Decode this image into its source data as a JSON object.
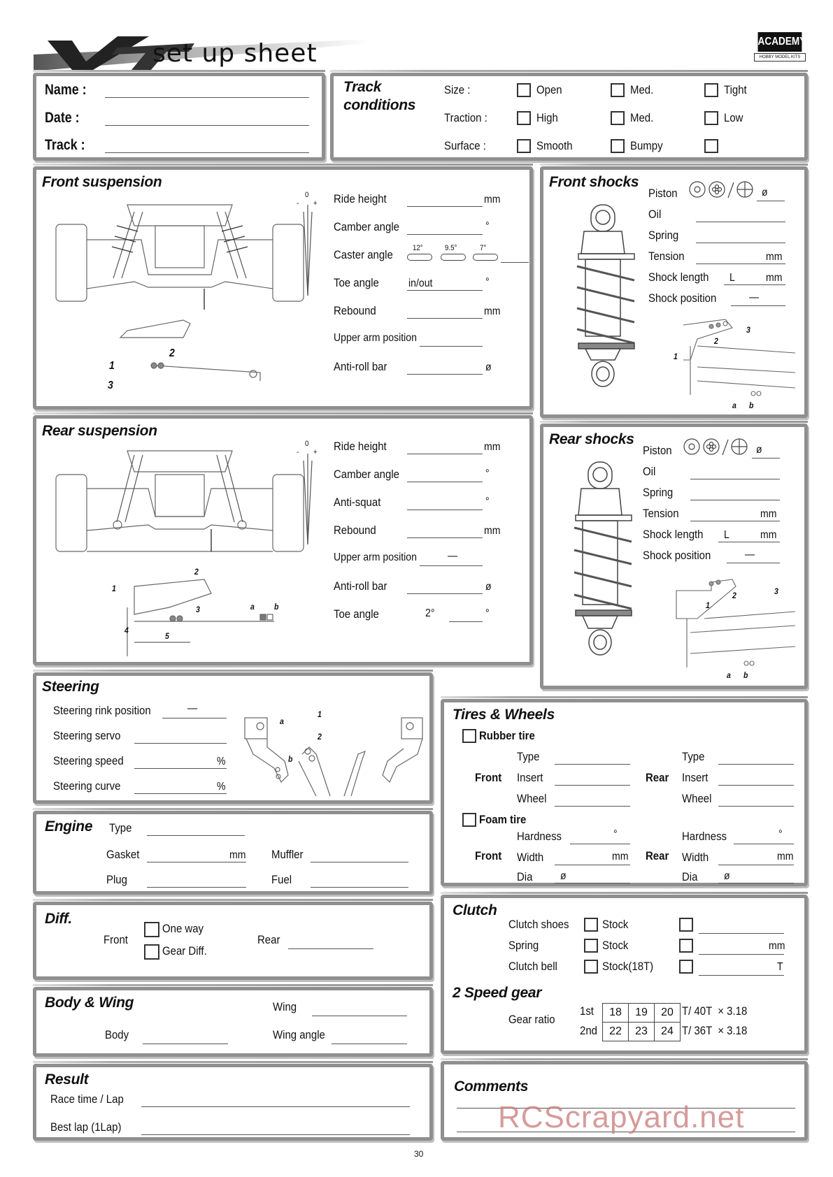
{
  "header": {
    "logo_text": "VT",
    "title": "set up sheet",
    "brand": "ACADEMY",
    "brand_sub": "HOBBY MODEL KITS"
  },
  "info": {
    "name_label": "Name :",
    "date_label": "Date :",
    "track_label": "Track :"
  },
  "track_conditions": {
    "title_line1": "Track",
    "title_line2": "conditions",
    "rows": [
      {
        "label": "Size :",
        "options": [
          "Open",
          "Med.",
          "Tight"
        ]
      },
      {
        "label": "Traction :",
        "options": [
          "High",
          "Med.",
          "Low"
        ]
      },
      {
        "label": "Surface :",
        "options": [
          "Smooth",
          "Bumpy",
          ""
        ]
      }
    ]
  },
  "front_suspension": {
    "title": "Front suspension",
    "gauge": {
      "zero": "0",
      "minus": "-",
      "plus": "+"
    },
    "fields": [
      {
        "label": "Ride height",
        "unit": "mm"
      },
      {
        "label": "Camber angle",
        "unit": "°"
      },
      {
        "label": "Caster angle",
        "unit": ""
      },
      {
        "label": "Toe angle",
        "unit": "°",
        "value": "in/out"
      },
      {
        "label": "Rebound",
        "unit": "mm"
      },
      {
        "label": "Upper arm position",
        "unit": ""
      },
      {
        "label": "Anti-roll bar",
        "unit": "ø"
      }
    ],
    "caster_options": [
      "12°",
      "9.5°",
      "7°"
    ],
    "diagram_labels": [
      "1",
      "2",
      "3"
    ]
  },
  "front_shocks": {
    "title": "Front shocks",
    "fields": [
      {
        "label": "Piston",
        "unit": "ø"
      },
      {
        "label": "Oil",
        "unit": ""
      },
      {
        "label": "Spring",
        "unit": ""
      },
      {
        "label": "Tension",
        "unit": "mm"
      },
      {
        "label": "Shock length",
        "unit": "mm",
        "prefix": "L"
      },
      {
        "label": "Shock position",
        "unit": "",
        "value": "—"
      }
    ],
    "diagram_labels": [
      "1",
      "2",
      "3",
      "a",
      "b"
    ]
  },
  "rear_suspension": {
    "title": "Rear suspension",
    "gauge": {
      "zero": "0",
      "minus": "-",
      "plus": "+"
    },
    "fields": [
      {
        "label": "Ride height",
        "unit": "mm"
      },
      {
        "label": "Camber angle",
        "unit": "°"
      },
      {
        "label": "Anti-squat",
        "unit": "°"
      },
      {
        "label": "Rebound",
        "unit": "mm"
      },
      {
        "label": "Upper arm position",
        "unit": "",
        "value": "—"
      },
      {
        "label": "Anti-roll bar",
        "unit": "ø"
      },
      {
        "label": "Toe angle",
        "unit": "°",
        "value": "2°"
      }
    ],
    "diagram_labels": [
      "1",
      "2",
      "3",
      "4",
      "5",
      "a",
      "b"
    ]
  },
  "rear_shocks": {
    "title": "Rear shocks",
    "fields": [
      {
        "label": "Piston",
        "unit": "ø"
      },
      {
        "label": "Oil",
        "unit": ""
      },
      {
        "label": "Spring",
        "unit": ""
      },
      {
        "label": "Tension",
        "unit": "mm"
      },
      {
        "label": "Shock length",
        "unit": "mm",
        "prefix": "L"
      },
      {
        "label": "Shock position",
        "unit": "",
        "value": "—"
      }
    ],
    "diagram_labels": [
      "1",
      "2",
      "3",
      "a",
      "b"
    ]
  },
  "steering": {
    "title": "Steering",
    "fields": [
      {
        "label": "Steering rink position",
        "unit": "",
        "value": "—"
      },
      {
        "label": "Steering servo",
        "unit": ""
      },
      {
        "label": "Steering speed",
        "unit": "%"
      },
      {
        "label": "Steering curve",
        "unit": "%"
      }
    ],
    "diagram_labels": [
      "a",
      "b",
      "1",
      "2"
    ]
  },
  "tires": {
    "title": "Tires & Wheels",
    "rubber_label": "Rubber tire",
    "foam_label": "Foam tire",
    "front_label": "Front",
    "rear_label": "Rear",
    "rubber_fields": [
      "Type",
      "Insert",
      "Wheel"
    ],
    "foam_fields": [
      {
        "label": "Hardness",
        "unit": "°",
        "prefix": ""
      },
      {
        "label": "Width",
        "unit": "mm",
        "prefix": ""
      },
      {
        "label": "Dia",
        "unit": "",
        "prefix": "ø"
      }
    ]
  },
  "engine": {
    "title": "Engine",
    "type_label": "Type",
    "gasket_label": "Gasket",
    "gasket_unit": "mm",
    "plug_label": "Plug",
    "muffler_label": "Muffler",
    "fuel_label": "Fuel"
  },
  "diff": {
    "title": "Diff.",
    "front_label": "Front",
    "options": [
      "One way",
      "Gear Diff."
    ],
    "rear_label": "Rear"
  },
  "clutch": {
    "title": "Clutch",
    "rows": [
      {
        "label": "Clutch shoes",
        "option": "Stock",
        "unit": ""
      },
      {
        "label": "Spring",
        "option": "Stock",
        "unit": "mm"
      },
      {
        "label": "Clutch bell",
        "option": "Stock(18T)",
        "unit": "T"
      }
    ]
  },
  "body_wing": {
    "title": "Body & Wing",
    "body_label": "Body",
    "wing_label": "Wing",
    "wing_angle_label": "Wing angle"
  },
  "two_speed": {
    "title": "2 Speed gear",
    "gear_ratio_label": "Gear ratio",
    "rows": [
      {
        "label": "1st",
        "values": [
          "18",
          "19",
          "20"
        ],
        "suffix": "T/ 40T  × 3.18"
      },
      {
        "label": "2nd",
        "values": [
          "22",
          "23",
          "24"
        ],
        "suffix": "T/ 36T  × 3.18"
      }
    ]
  },
  "result": {
    "title": "Result",
    "race_time_label": "Race time / Lap",
    "best_lap_label": "Best lap (1Lap)"
  },
  "comments": {
    "title": "Comments"
  },
  "footer": {
    "page_number": "30",
    "watermark": "RCScrapyard.net"
  }
}
